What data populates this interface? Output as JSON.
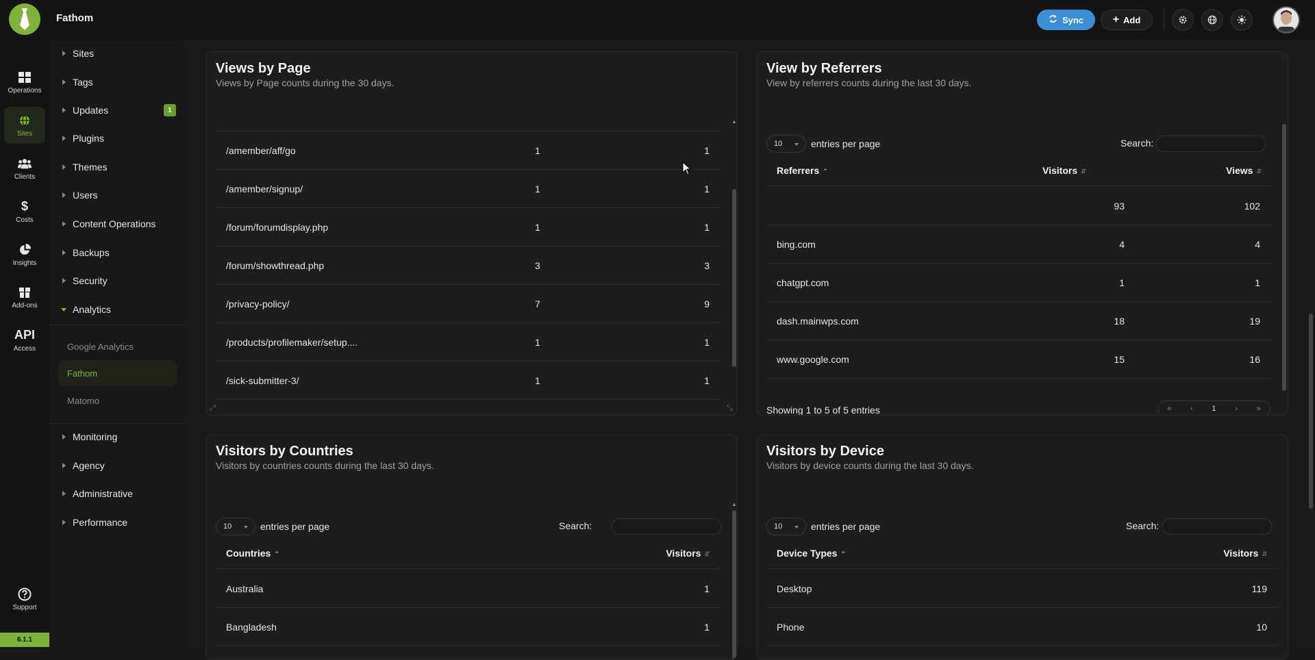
{
  "app": {
    "title": "Fathom",
    "version": "6.1.1"
  },
  "topbar": {
    "sync_label": "Sync",
    "add_label": "Add"
  },
  "rail": [
    {
      "label": "Operations",
      "icon": "grid-icon"
    },
    {
      "label": "Sites",
      "icon": "globe-icon"
    },
    {
      "label": "Clients",
      "icon": "users-icon"
    },
    {
      "label": "Costs",
      "icon": "dollar-icon"
    },
    {
      "label": "Insights",
      "icon": "pie-chart-icon"
    },
    {
      "label": "Add-ons",
      "icon": "box-icon"
    },
    {
      "label": "Access",
      "icon": "api-icon",
      "icon_text": "API"
    },
    {
      "label": "Support",
      "icon": "help-icon"
    }
  ],
  "subnav": {
    "items": [
      "Sites",
      "Tags",
      "Updates",
      "Plugins",
      "Themes",
      "Users",
      "Content Operations",
      "Backups",
      "Security",
      "Analytics"
    ],
    "updates_badge": "1",
    "analytics_children": [
      "Google Analytics",
      "Fathom",
      "Matomo"
    ],
    "after": [
      "Monitoring",
      "Agency",
      "Administrative",
      "Performance"
    ]
  },
  "views_by_page": {
    "title": "Views by Page",
    "subtitle": "Views by Page counts during the 30 days.",
    "rows": [
      {
        "page": "/amember/aff/go",
        "visitors": "1",
        "views": "1"
      },
      {
        "page": "/amember/signup/",
        "visitors": "1",
        "views": "1"
      },
      {
        "page": "/forum/forumdisplay.php",
        "visitors": "1",
        "views": "1"
      },
      {
        "page": "/forum/showthread.php",
        "visitors": "3",
        "views": "3"
      },
      {
        "page": "/privacy-policy/",
        "visitors": "7",
        "views": "9"
      },
      {
        "page": "/products/profilemaker/setup....",
        "visitors": "1",
        "views": "1"
      },
      {
        "page": "/sick-submitter-3/",
        "visitors": "1",
        "views": "1"
      }
    ]
  },
  "referrers": {
    "title": "View by Referrers",
    "subtitle": "View by referrers counts during the last 30 days.",
    "length_value": "10",
    "length_label": "entries per page",
    "search_label": "Search:",
    "headers": {
      "c1": "Referrers",
      "c2": "Visitors",
      "c3": "Views"
    },
    "rows": [
      {
        "ref": "",
        "visitors": "93",
        "views": "102"
      },
      {
        "ref": "bing.com",
        "visitors": "4",
        "views": "4"
      },
      {
        "ref": "chatgpt.com",
        "visitors": "1",
        "views": "1"
      },
      {
        "ref": "dash.mainwps.com",
        "visitors": "18",
        "views": "19"
      },
      {
        "ref": "www.google.com",
        "visitors": "15",
        "views": "16"
      }
    ],
    "info": "Showing 1 to 5 of 5 entries",
    "pager": {
      "first": "«",
      "prev": "‹",
      "page": "1",
      "next": "›",
      "last": "»"
    }
  },
  "countries": {
    "title": "Visitors by Countries",
    "subtitle": "Visitors by countries counts during the last 30 days.",
    "length_value": "10",
    "length_label": "entries per page",
    "search_label": "Search:",
    "headers": {
      "c1": "Countries",
      "c2": "Visitors"
    },
    "rows": [
      {
        "name": "Australia",
        "visitors": "1"
      },
      {
        "name": "Bangladesh",
        "visitors": "1"
      }
    ]
  },
  "devices": {
    "title": "Visitors by Device",
    "subtitle": "Visitors by device counts during the last 30 days.",
    "length_value": "10",
    "length_label": "entries per page",
    "search_label": "Search:",
    "headers": {
      "c1": "Device Types",
      "c2": "Visitors"
    },
    "rows": [
      {
        "name": "Desktop",
        "visitors": "119"
      },
      {
        "name": "Phone",
        "visitors": "10"
      }
    ]
  },
  "colors": {
    "accent": "#7fb238",
    "sync": "#3a8fd6",
    "bg": "#181818"
  }
}
